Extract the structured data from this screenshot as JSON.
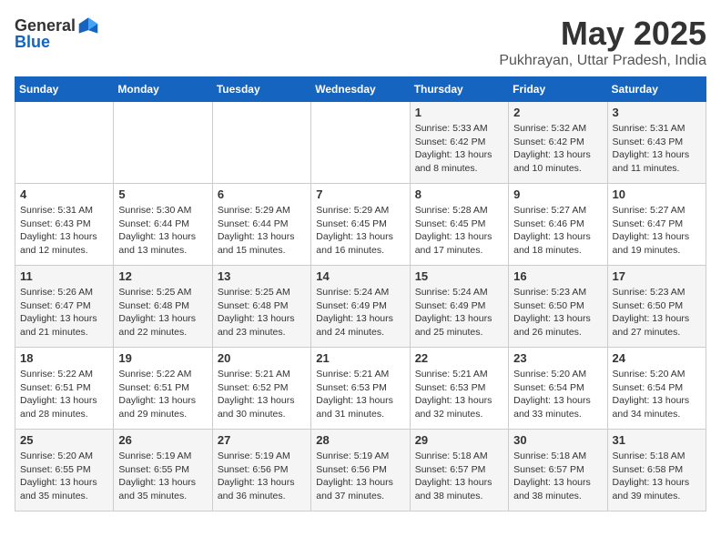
{
  "header": {
    "logo_general": "General",
    "logo_blue": "Blue",
    "title": "May 2025",
    "subtitle": "Pukhrayan, Uttar Pradesh, India"
  },
  "days_of_week": [
    "Sunday",
    "Monday",
    "Tuesday",
    "Wednesday",
    "Thursday",
    "Friday",
    "Saturday"
  ],
  "weeks": [
    [
      {
        "day": "",
        "info": ""
      },
      {
        "day": "",
        "info": ""
      },
      {
        "day": "",
        "info": ""
      },
      {
        "day": "",
        "info": ""
      },
      {
        "day": "1",
        "info": "Sunrise: 5:33 AM\nSunset: 6:42 PM\nDaylight: 13 hours\nand 8 minutes."
      },
      {
        "day": "2",
        "info": "Sunrise: 5:32 AM\nSunset: 6:42 PM\nDaylight: 13 hours\nand 10 minutes."
      },
      {
        "day": "3",
        "info": "Sunrise: 5:31 AM\nSunset: 6:43 PM\nDaylight: 13 hours\nand 11 minutes."
      }
    ],
    [
      {
        "day": "4",
        "info": "Sunrise: 5:31 AM\nSunset: 6:43 PM\nDaylight: 13 hours\nand 12 minutes."
      },
      {
        "day": "5",
        "info": "Sunrise: 5:30 AM\nSunset: 6:44 PM\nDaylight: 13 hours\nand 13 minutes."
      },
      {
        "day": "6",
        "info": "Sunrise: 5:29 AM\nSunset: 6:44 PM\nDaylight: 13 hours\nand 15 minutes."
      },
      {
        "day": "7",
        "info": "Sunrise: 5:29 AM\nSunset: 6:45 PM\nDaylight: 13 hours\nand 16 minutes."
      },
      {
        "day": "8",
        "info": "Sunrise: 5:28 AM\nSunset: 6:45 PM\nDaylight: 13 hours\nand 17 minutes."
      },
      {
        "day": "9",
        "info": "Sunrise: 5:27 AM\nSunset: 6:46 PM\nDaylight: 13 hours\nand 18 minutes."
      },
      {
        "day": "10",
        "info": "Sunrise: 5:27 AM\nSunset: 6:47 PM\nDaylight: 13 hours\nand 19 minutes."
      }
    ],
    [
      {
        "day": "11",
        "info": "Sunrise: 5:26 AM\nSunset: 6:47 PM\nDaylight: 13 hours\nand 21 minutes."
      },
      {
        "day": "12",
        "info": "Sunrise: 5:25 AM\nSunset: 6:48 PM\nDaylight: 13 hours\nand 22 minutes."
      },
      {
        "day": "13",
        "info": "Sunrise: 5:25 AM\nSunset: 6:48 PM\nDaylight: 13 hours\nand 23 minutes."
      },
      {
        "day": "14",
        "info": "Sunrise: 5:24 AM\nSunset: 6:49 PM\nDaylight: 13 hours\nand 24 minutes."
      },
      {
        "day": "15",
        "info": "Sunrise: 5:24 AM\nSunset: 6:49 PM\nDaylight: 13 hours\nand 25 minutes."
      },
      {
        "day": "16",
        "info": "Sunrise: 5:23 AM\nSunset: 6:50 PM\nDaylight: 13 hours\nand 26 minutes."
      },
      {
        "day": "17",
        "info": "Sunrise: 5:23 AM\nSunset: 6:50 PM\nDaylight: 13 hours\nand 27 minutes."
      }
    ],
    [
      {
        "day": "18",
        "info": "Sunrise: 5:22 AM\nSunset: 6:51 PM\nDaylight: 13 hours\nand 28 minutes."
      },
      {
        "day": "19",
        "info": "Sunrise: 5:22 AM\nSunset: 6:51 PM\nDaylight: 13 hours\nand 29 minutes."
      },
      {
        "day": "20",
        "info": "Sunrise: 5:21 AM\nSunset: 6:52 PM\nDaylight: 13 hours\nand 30 minutes."
      },
      {
        "day": "21",
        "info": "Sunrise: 5:21 AM\nSunset: 6:53 PM\nDaylight: 13 hours\nand 31 minutes."
      },
      {
        "day": "22",
        "info": "Sunrise: 5:21 AM\nSunset: 6:53 PM\nDaylight: 13 hours\nand 32 minutes."
      },
      {
        "day": "23",
        "info": "Sunrise: 5:20 AM\nSunset: 6:54 PM\nDaylight: 13 hours\nand 33 minutes."
      },
      {
        "day": "24",
        "info": "Sunrise: 5:20 AM\nSunset: 6:54 PM\nDaylight: 13 hours\nand 34 minutes."
      }
    ],
    [
      {
        "day": "25",
        "info": "Sunrise: 5:20 AM\nSunset: 6:55 PM\nDaylight: 13 hours\nand 35 minutes."
      },
      {
        "day": "26",
        "info": "Sunrise: 5:19 AM\nSunset: 6:55 PM\nDaylight: 13 hours\nand 35 minutes."
      },
      {
        "day": "27",
        "info": "Sunrise: 5:19 AM\nSunset: 6:56 PM\nDaylight: 13 hours\nand 36 minutes."
      },
      {
        "day": "28",
        "info": "Sunrise: 5:19 AM\nSunset: 6:56 PM\nDaylight: 13 hours\nand 37 minutes."
      },
      {
        "day": "29",
        "info": "Sunrise: 5:18 AM\nSunset: 6:57 PM\nDaylight: 13 hours\nand 38 minutes."
      },
      {
        "day": "30",
        "info": "Sunrise: 5:18 AM\nSunset: 6:57 PM\nDaylight: 13 hours\nand 38 minutes."
      },
      {
        "day": "31",
        "info": "Sunrise: 5:18 AM\nSunset: 6:58 PM\nDaylight: 13 hours\nand 39 minutes."
      }
    ]
  ]
}
